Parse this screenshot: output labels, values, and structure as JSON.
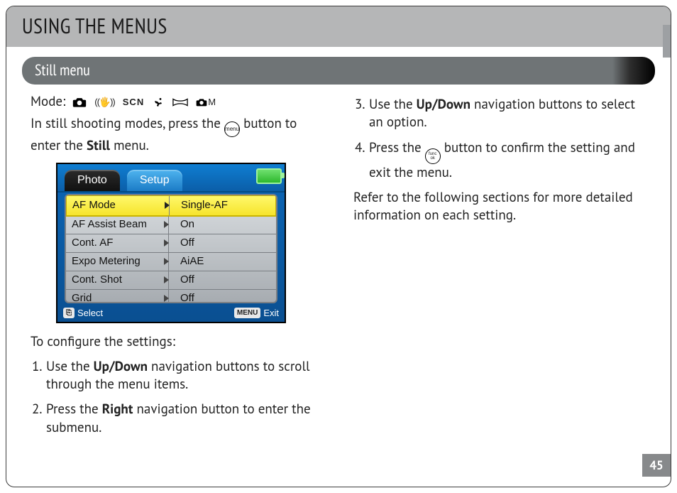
{
  "header": {
    "title": "USING THE MENUS"
  },
  "section": {
    "title": "Still menu"
  },
  "left": {
    "mode_label": "Mode:",
    "mode_icons": {
      "scn": "SCN",
      "m": "M"
    },
    "intro_a": "In still shooting modes, press the ",
    "intro_b": " button to enter the ",
    "intro_bold": "Still",
    "intro_c": " menu.",
    "menu_btn_label": "menu",
    "configure": "To configure the settings:",
    "step1_a": "Use the ",
    "step1_bold": "Up/Down",
    "step1_b": " navigation buttons to scroll through the menu items.",
    "step2_a": "Press the ",
    "step2_bold": "Right",
    "step2_b": " navigation button to enter the submenu."
  },
  "right": {
    "step3_a": "Use the ",
    "step3_bold": "Up/Down",
    "step3_b": " navigation buttons to select an option.",
    "step4_a": "Press the ",
    "step4_b": " button to confirm the setting and exit the menu.",
    "func_top": "func",
    "func_bot": "ok",
    "refer": "Refer to the following sections for more detailed information on each setting."
  },
  "lcd": {
    "tab_inactive": "Photo",
    "tab_active": "Setup",
    "rows": {
      "0": {
        "label": "AF Mode",
        "value": "Single-AF"
      },
      "1": {
        "label": "AF Assist Beam",
        "value": "On"
      },
      "2": {
        "label": "Cont. AF",
        "value": "Off"
      },
      "3": {
        "label": "Expo Metering",
        "value": "AiAE"
      },
      "4": {
        "label": "Cont. Shot",
        "value": "Off"
      },
      "5": {
        "label": "Grid",
        "value": "Off"
      }
    },
    "foot_select_badge": "⎘",
    "foot_select": "Select",
    "foot_exit_badge": "MENU",
    "foot_exit": "Exit"
  },
  "page_number": "45"
}
